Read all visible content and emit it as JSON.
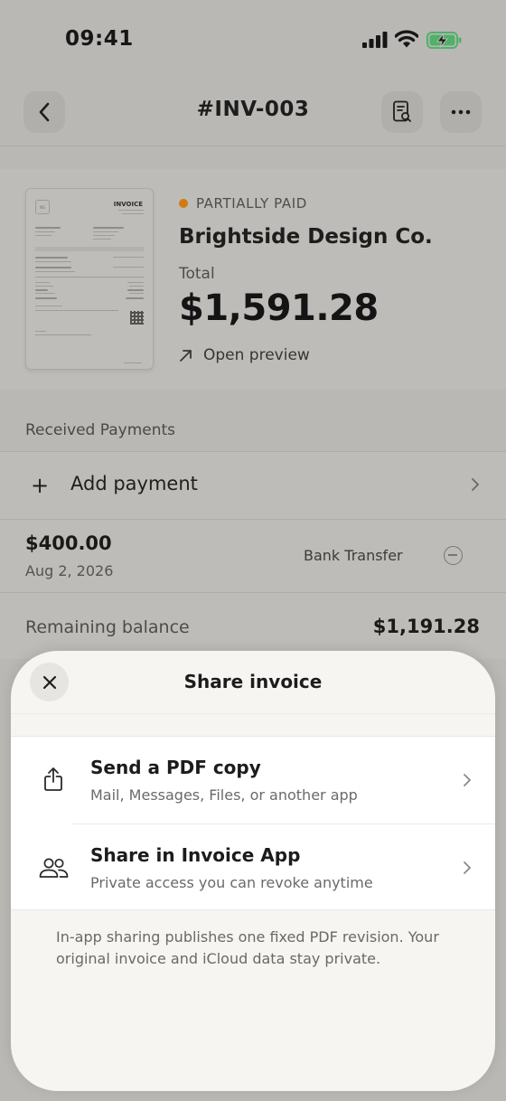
{
  "status_bar": {
    "time": "09:41"
  },
  "nav": {
    "title": "#INV-003",
    "back_icon": "chevron-left-icon",
    "preview_icon": "document-search-icon",
    "more_icon": "ellipsis-icon"
  },
  "invoice_card": {
    "thumbnail": {
      "heading": "INVOICE",
      "logo_text": "NS"
    },
    "status": "PARTIALLY PAID",
    "status_color": "#d07b10",
    "client": "Brightside Design Co.",
    "total_label": "Total",
    "total_amount": "$1,591.28",
    "open_preview": "Open preview"
  },
  "payments": {
    "section_label": "Received Payments",
    "add_payment": "Add payment",
    "items": [
      {
        "amount": "$400.00",
        "date": "Aug 2, 2026",
        "method": "Bank Transfer"
      }
    ],
    "remaining_label": "Remaining balance",
    "remaining_amount": "$1,191.28"
  },
  "share_sheet": {
    "title": "Share invoice",
    "options": [
      {
        "title": "Send a PDF copy",
        "subtitle": "Mail, Messages, Files, or another app",
        "icon": "share-icon"
      },
      {
        "title": "Share in Invoice App",
        "subtitle": "Private access you can revoke anytime",
        "icon": "people-icon"
      }
    ],
    "note": "In-app sharing publishes one fixed PDF revision. Your original invoice and iCloud data stay private."
  }
}
